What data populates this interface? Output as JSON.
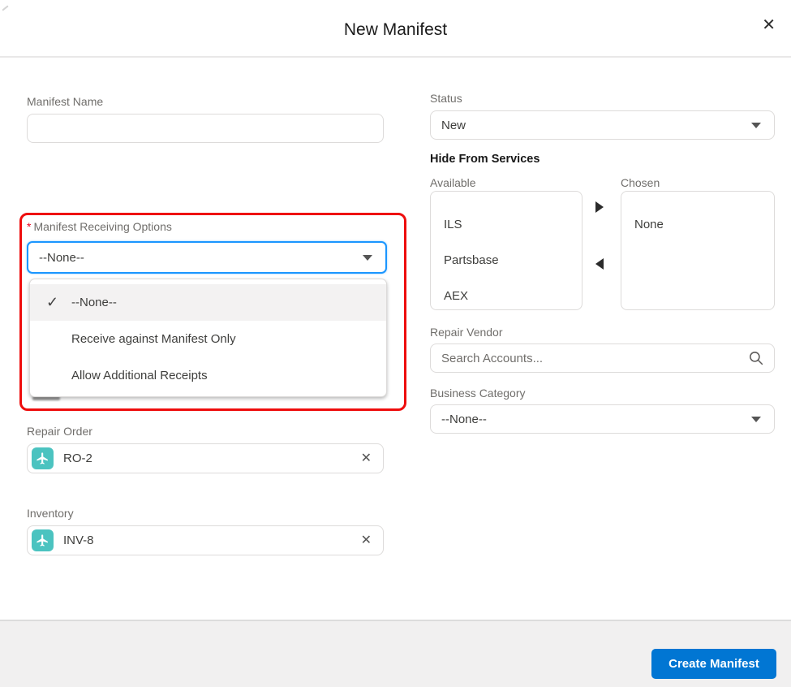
{
  "modal": {
    "title": "New Manifest",
    "close_glyph": "✕"
  },
  "left": {
    "manifest_name": {
      "label": "Manifest Name",
      "value": ""
    },
    "receiving_options": {
      "required_marker": "*",
      "label": "Manifest Receiving Options",
      "value": "--None--",
      "dropdown": {
        "check_glyph": "✓",
        "selected_option": "--None--",
        "options": [
          "--None--",
          "Receive against Manifest Only",
          "Allow Additional Receipts"
        ]
      }
    },
    "repair_order": {
      "label": "Repair Order",
      "value": "RO-2",
      "remove_glyph": "✕"
    },
    "inventory": {
      "label": "Inventory",
      "value": "INV-8",
      "remove_glyph": "✕"
    }
  },
  "right": {
    "status": {
      "label": "Status",
      "value": "New"
    },
    "hide_from_services": {
      "title": "Hide From Services",
      "available": {
        "label": "Available",
        "items": [
          "ILS",
          "Partsbase",
          "AEX"
        ]
      },
      "chosen": {
        "label": "Chosen",
        "items": [
          "None"
        ]
      }
    },
    "repair_vendor": {
      "label": "Repair Vendor",
      "placeholder": "Search Accounts..."
    },
    "business_category": {
      "label": "Business Category",
      "value": "--None--"
    }
  },
  "footer": {
    "create_button_label": "Create Manifest"
  },
  "colors": {
    "accent_blue": "#0176d3",
    "focus_blue": "#1b96ff",
    "annotation_red": "#ee0d0d",
    "record_icon_teal": "#4bc3c0",
    "label_gray": "#706e6b",
    "required_red": "#ea001e",
    "footer_gray": "#f1f0f0",
    "selected_row_gray": "#f3f2f2"
  }
}
